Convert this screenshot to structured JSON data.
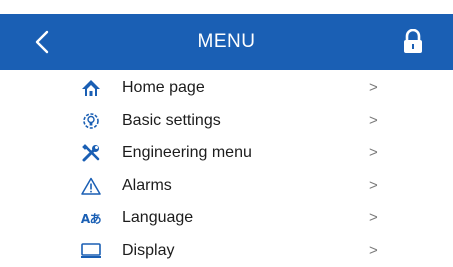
{
  "header": {
    "title": "MENU",
    "back_icon": "chevron-left-icon",
    "lock_icon": "lock-icon",
    "background_color": "#1a5fb4"
  },
  "menu": {
    "chevron": ">",
    "items": [
      {
        "label": "Home page",
        "icon": "home-icon"
      },
      {
        "label": "Basic settings",
        "icon": "bulb-settings-icon"
      },
      {
        "label": "Engineering menu",
        "icon": "tools-icon"
      },
      {
        "label": "Alarms",
        "icon": "warning-icon"
      },
      {
        "label": "Language",
        "icon": "language-icon",
        "icon_text": "Aあ"
      },
      {
        "label": "Display",
        "icon": "display-icon"
      }
    ]
  }
}
